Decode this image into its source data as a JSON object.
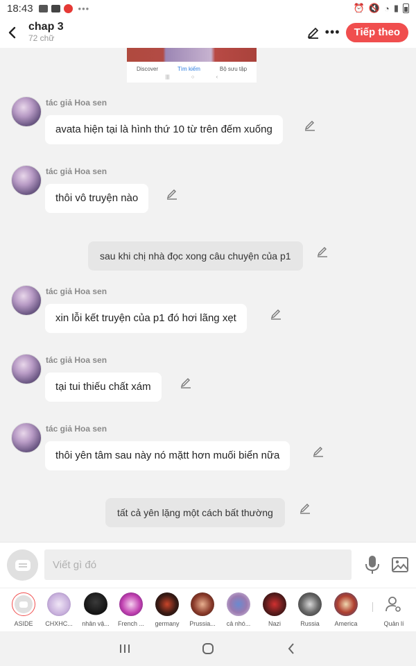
{
  "status_bar": {
    "time": "18:43"
  },
  "header": {
    "title": "chap 3",
    "subtitle": "72 chữ",
    "next_label": "Tiếp theo"
  },
  "thumbnail": {
    "tabs": [
      "Discover",
      "Tìm kiếm",
      "Bộ sưu tập"
    ]
  },
  "messages": [
    {
      "type": "character",
      "author": "tác giả Hoa sen",
      "text": "avata hiện tại là hình thứ 10 từ trên đếm xuống"
    },
    {
      "type": "character",
      "author": "tác giả Hoa sen",
      "text": "thôi vô truyện nào"
    },
    {
      "type": "narration",
      "text": "sau khi chị nhà đọc xong câu chuyện của p1"
    },
    {
      "type": "character",
      "author": "tác giả Hoa sen",
      "text": "xin lỗi kết truyện của p1 đó hơi lãng xẹt"
    },
    {
      "type": "character",
      "author": "tác giả Hoa sen",
      "text": "tại tui thiếu chất xám"
    },
    {
      "type": "character",
      "author": "tác giả Hoa sen",
      "text": "thôi yên tâm sau này nó mặtt hơn muối biển nữa"
    },
    {
      "type": "narration",
      "text": "tất cả yên lặng một cách bất thường"
    }
  ],
  "composer": {
    "placeholder": "Viết gì đó"
  },
  "characters": [
    {
      "name": "ASIDE",
      "color": "#ffffff"
    },
    {
      "name": "CHXHC...",
      "color": "#d9c8e6"
    },
    {
      "name": "nhân vậ...",
      "color": "#2a2a2a"
    },
    {
      "name": "French ...",
      "color": "#c040b0"
    },
    {
      "name": "germany",
      "color": "#3a1a14"
    },
    {
      "name": "Prussia...",
      "color": "#6a2a20"
    },
    {
      "name": "cả nhó...",
      "color": "#9a7ab0"
    },
    {
      "name": "Nazi",
      "color": "#5a1c1c"
    },
    {
      "name": "Russia",
      "color": "#4a4a4a"
    },
    {
      "name": "America",
      "color": "#b04030"
    }
  ],
  "manage_label": "Quản lí"
}
